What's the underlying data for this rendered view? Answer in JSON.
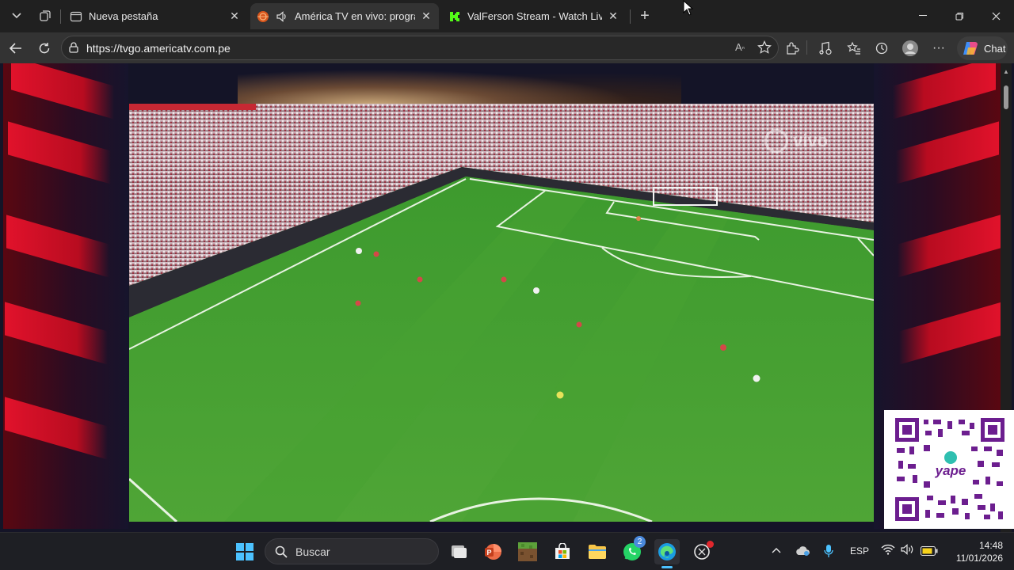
{
  "tabs": [
    {
      "title": "Nueva pestaña",
      "active": false,
      "favicon": "new-tab-icon"
    },
    {
      "title": "América TV en vivo: programa",
      "active": true,
      "favicon": "america-tv-icon",
      "audio": true
    },
    {
      "title": "ValFerson Stream - Watch Live on",
      "active": false,
      "favicon": "kick-icon"
    }
  ],
  "address": {
    "url": "https://tvgo.americatv.com.pe"
  },
  "toolbar": {
    "chat_label": "Chat"
  },
  "video": {
    "watermark": "vivo"
  },
  "qr": {
    "brand": "yape"
  },
  "taskbar": {
    "search_placeholder": "Buscar",
    "whatsapp_badge": "2",
    "language": "ESP",
    "time": "14:48",
    "date": "11/01/2026"
  },
  "colors": {
    "accent_red": "#e1122b",
    "yape_purple": "#6c1e8f",
    "pitch_green": "#4a9a30"
  }
}
